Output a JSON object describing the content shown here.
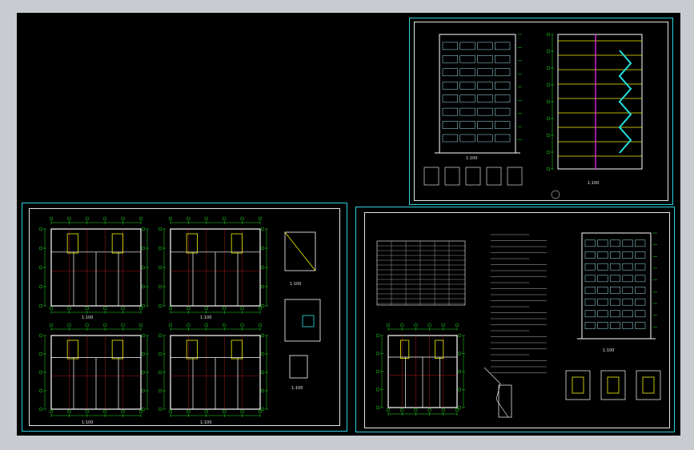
{
  "drawing": {
    "sheets": [
      {
        "id": "elevation-section-sheet"
      },
      {
        "id": "floor-plans-sheet"
      },
      {
        "id": "notes-elevation-sheet"
      }
    ],
    "label_scale": "1:100",
    "colors": {
      "background": "#000000",
      "sheet_border": "#2fd3e0",
      "inner_frame": "#e6e6e6",
      "walls": "#ffffff",
      "grid_axis": "#d02020",
      "dimension": "#22e022",
      "highlight": "#f2f200",
      "stair": "#22e0e0",
      "accent": "#ff30ff"
    }
  }
}
